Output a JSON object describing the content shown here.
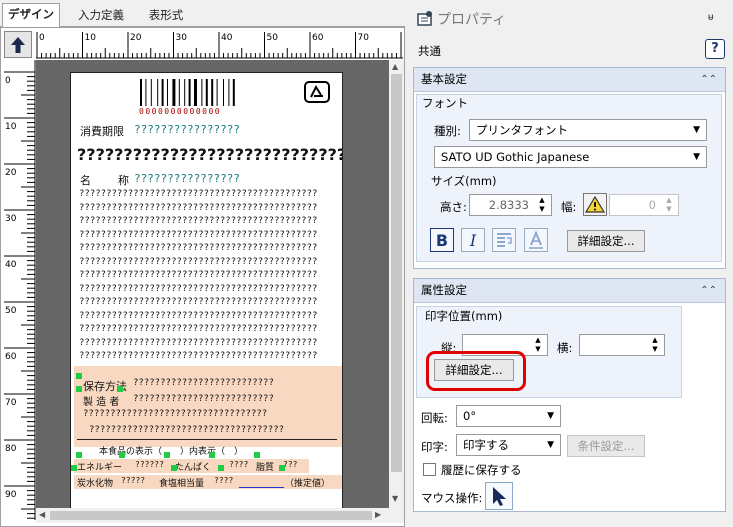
{
  "tabs": [
    {
      "label": "デザイン"
    },
    {
      "label": "入力定義"
    },
    {
      "label": "表形式"
    }
  ],
  "ruler": {
    "h": [
      "0",
      "10",
      "20",
      "30",
      "40",
      "50",
      "60",
      "70"
    ],
    "v": [
      "0",
      "10",
      "20",
      "30",
      "40",
      "50",
      "60",
      "70",
      "80",
      "90"
    ]
  },
  "label": {
    "barcode_digits": "0000000000000",
    "row1_label": "消費期限",
    "row1_value": "????????????????",
    "row2": "?????????????????????????????",
    "row3_label": "名　称",
    "row3_value": "????????????????",
    "body_line": "????????????????????????????????????????????",
    "storage_label": "保存方法",
    "storage_value": "??????????????????????????",
    "r2_label": "製 造 者",
    "r2_value": "??????????????????????????",
    "r3": "??????????????????????????????????",
    "r4": "????????????????????????????????????",
    "r5": "本食品の表示（　　）内表示（　）",
    "r6a": "エネルギー",
    "r6b": "??????",
    "r6c": "たんぱく",
    "r6d": "????",
    "r6e": "脂質",
    "r6f": "???",
    "r7a": "炭水化物",
    "r7b": "?????",
    "r7c": "食塩相当量",
    "r7d": "????",
    "r7e": "（推定値）"
  },
  "props": {
    "title": "プロパティ",
    "pin": "ᵾ",
    "common": "共通",
    "help": "?",
    "basic": {
      "title": "基本設定",
      "font_group": "フォント",
      "type_label": "種別:",
      "type_value": "プリンタフォント",
      "font_value": "SATO UD Gothic Japanese",
      "size_label": "サイズ(mm)",
      "height_label": "高さ:",
      "height_value": "2.8333",
      "width_label": "幅:",
      "width_value": "0",
      "bold": "B",
      "italic": "I",
      "detail_button": "詳細設定..."
    },
    "attr": {
      "title": "属性設定",
      "pos_group": "印字位置(mm)",
      "vert_label": "縦:",
      "horiz_label": "横:",
      "detail_button": "詳細設定...",
      "rotate_label": "回転:",
      "rotate_value": "0°",
      "print_label": "印字:",
      "print_value": "印字する",
      "cond_button": "条件設定...",
      "history_label": "履歴に保存する",
      "mouse_label": "マウス操作:"
    }
  },
  "colors": {
    "accent": "#e00000",
    "header": "#dde6f2",
    "selection": "#f8d8c0",
    "handle": "#22cc44"
  }
}
